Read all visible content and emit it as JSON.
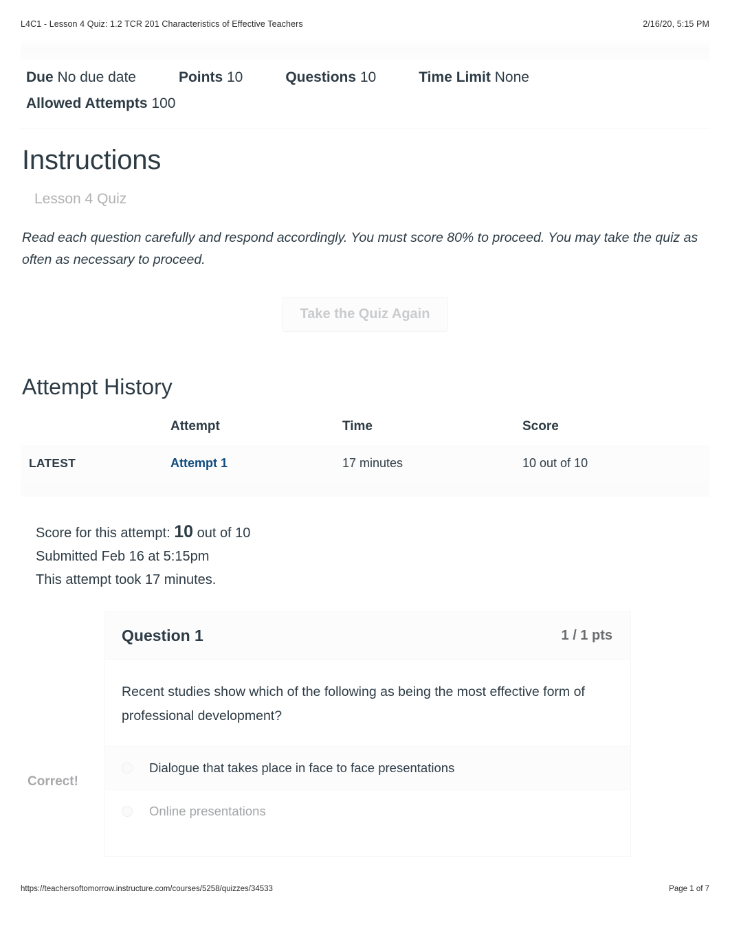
{
  "print": {
    "header_title": "L4C1 - Lesson 4 Quiz: 1.2 TCR 201 Characteristics of Effective Teachers",
    "header_date": "2/16/20, 5:15 PM",
    "footer_url": "https://teachersoftomorrow.instructure.com/courses/5258/quizzes/34533",
    "footer_page": "Page 1 of 7"
  },
  "quiz_meta": {
    "due_label": "Due",
    "due_value": "No due date",
    "points_label": "Points",
    "points_value": "10",
    "questions_label": "Questions",
    "questions_value": "10",
    "time_limit_label": "Time Limit",
    "time_limit_value": "None",
    "allowed_attempts_label": "Allowed Attempts",
    "allowed_attempts_value": "100"
  },
  "instructions": {
    "heading": "Instructions",
    "subheading": "Lesson 4 Quiz",
    "body": "Read each question carefully and respond accordingly.   You must score 80% to proceed.   You may take the quiz as often as necessary to proceed.",
    "retake_button": "Take the Quiz Again"
  },
  "attempt_history": {
    "heading": "Attempt History",
    "columns": [
      "",
      "Attempt",
      "Time",
      "Score"
    ],
    "rows": [
      {
        "tag": "LATEST",
        "attempt": "Attempt 1",
        "time": "17 minutes",
        "score": "10 out of 10"
      }
    ]
  },
  "attempt_summary": {
    "score_prefix": "Score for this attempt:",
    "score_value": "10",
    "score_suffix": "out of 10",
    "submitted": "Submitted Feb 16 at 5:15pm",
    "duration": "This attempt took 17 minutes."
  },
  "question": {
    "title": "Question 1",
    "points": "1 / 1 pts",
    "text": "Recent studies show which of the following as being the most effective form of professional development?",
    "correct_label": "Correct!",
    "answers": [
      {
        "text": "Dialogue that takes place in face to face presentations",
        "selected": true
      },
      {
        "text": "Online presentations",
        "selected": false
      }
    ]
  },
  "colors": {
    "link": "#0e4b7e",
    "text": "#2d3b45",
    "muted": "#a8a9ab"
  }
}
